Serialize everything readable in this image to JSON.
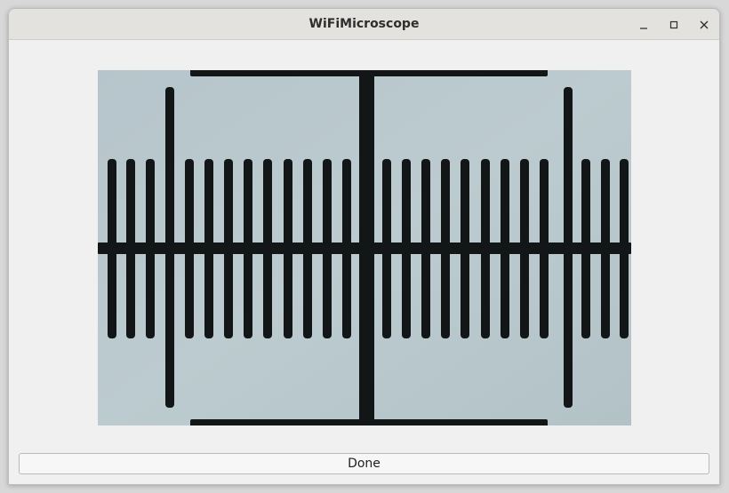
{
  "window": {
    "title": "WiFiMicroscope",
    "controls": {
      "minimize_icon": "minimize-icon",
      "maximize_icon": "maximize-icon",
      "close_icon": "close-icon"
    }
  },
  "viewer": {
    "image_subject": "microscope calibration ruler",
    "colors": {
      "background": "#b8c7cb",
      "ink": "#121617"
    }
  },
  "footer": {
    "done_label": "Done"
  }
}
